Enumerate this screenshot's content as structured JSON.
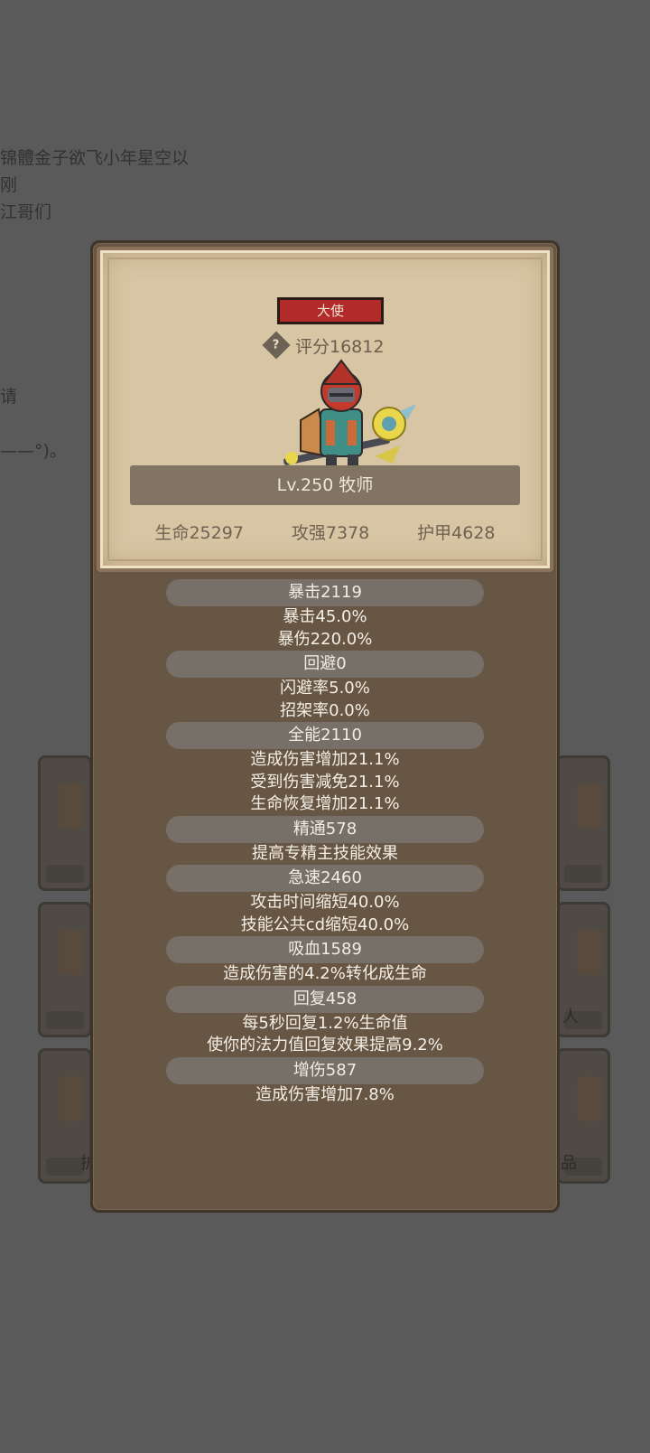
{
  "background": {
    "lines": [
      "锦體金子欲飞小年星空以",
      "刚",
      "江哥们",
      "请",
      "——°)。"
    ],
    "slot_labels": [
      "人",
      "护",
      "品"
    ]
  },
  "card": {
    "title_badge": "大使",
    "help_icon_glyph": "?",
    "score_label": "评分16812",
    "level_class": "Lv.250 牧师",
    "stats": {
      "hp": "生命25297",
      "attack": "攻强7378",
      "armor": "护甲4628"
    }
  },
  "details": {
    "crit": {
      "title": "暴击2119",
      "lines": [
        "暴击45.0%",
        "暴伤220.0%"
      ]
    },
    "dodge": {
      "title": "回避0",
      "lines": [
        "闪避率5.0%",
        "招架率0.0%"
      ]
    },
    "versatility": {
      "title": "全能2110",
      "lines": [
        "造成伤害增加21.1%",
        "受到伤害减免21.1%",
        "生命恢复增加21.1%"
      ]
    },
    "mastery": {
      "title": "精通578",
      "lines": [
        "提高专精主技能效果"
      ]
    },
    "haste": {
      "title": "急速2460",
      "lines": [
        "攻击时间缩短40.0%",
        "技能公共cd缩短40.0%"
      ]
    },
    "leech": {
      "title": "吸血1589",
      "lines": [
        "造成伤害的4.2%转化成生命"
      ]
    },
    "regen": {
      "title": "回复458",
      "lines": [
        "每5秒回复1.2%生命值",
        "使你的法力值回复效果提高9.2%"
      ]
    },
    "damage": {
      "title": "增伤587",
      "lines": [
        "造成伤害增加7.8%"
      ]
    }
  }
}
